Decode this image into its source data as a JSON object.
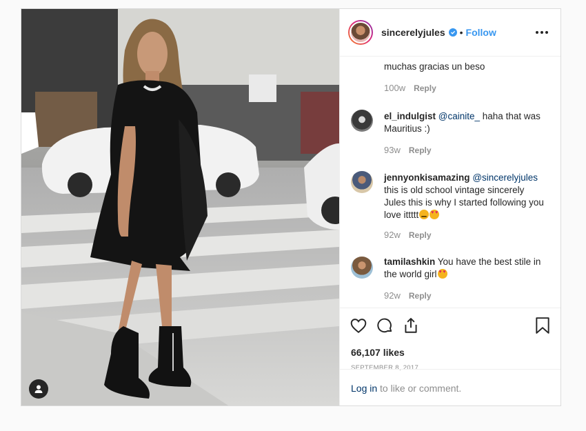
{
  "post": {
    "username": "sincerelyjules",
    "separator": "•",
    "follow_label": "Follow",
    "icons": {
      "verified": "verified-badge-icon",
      "more": "more-options-icon",
      "photo_user": "user-tag-icon",
      "like": "heart-icon",
      "comment": "comment-bubble-icon",
      "share": "share-icon",
      "save": "bookmark-icon"
    }
  },
  "comments": [
    {
      "user": "",
      "text": "muchas gracias un beso",
      "age": "100w",
      "reply": "Reply"
    },
    {
      "user": "el_indulgist",
      "mention": "@cainite_",
      "text": " haha that was Mauritius :)",
      "age": "93w",
      "reply": "Reply"
    },
    {
      "user": "jennyonkisamazing",
      "mention": "@sincerelyjules",
      "text": " this is old school vintage sincerely Jules this is why I started following you love ittttt",
      "age": "92w",
      "reply": "Reply"
    },
    {
      "user": "tamilashkin",
      "text": " You have the best stile in the world girl",
      "age": "92w",
      "reply": "Reply"
    }
  ],
  "stats": {
    "likes": "66,107 likes",
    "date": "SEPTEMBER 8, 2017"
  },
  "login": {
    "link": "Log in",
    "suffix": " to like or comment."
  }
}
